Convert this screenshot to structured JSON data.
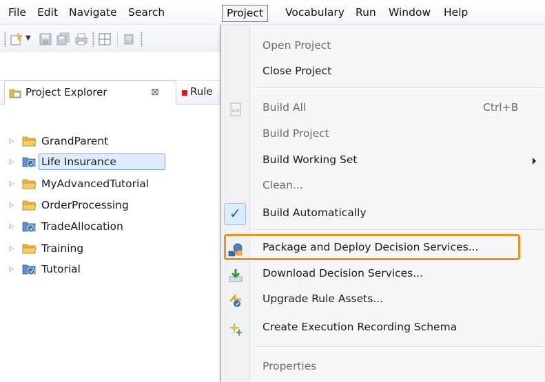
{
  "menubar": {
    "items": [
      {
        "label": "File"
      },
      {
        "label": "Edit"
      },
      {
        "label": "Navigate"
      },
      {
        "label": "Search"
      },
      {
        "label": "Project"
      },
      {
        "label": "Vocabulary"
      },
      {
        "label": "Run"
      },
      {
        "label": "Window"
      },
      {
        "label": "Help"
      }
    ],
    "active": "Project"
  },
  "explorer": {
    "tab_label": "Project Explorer",
    "close_symbol": "⊠",
    "other_tab_label": "Rule",
    "tree": [
      {
        "label": "GrandParent",
        "icon": "folder-icon"
      },
      {
        "label": "Life Insurance",
        "icon": "rule-project-icon",
        "selected": true
      },
      {
        "label": "MyAdvancedTutorial",
        "icon": "folder-icon"
      },
      {
        "label": "OrderProcessing",
        "icon": "folder-icon"
      },
      {
        "label": "TradeAllocation",
        "icon": "rule-project-icon"
      },
      {
        "label": "Training",
        "icon": "folder-icon"
      },
      {
        "label": "Tutorial",
        "icon": "rule-project-icon"
      }
    ]
  },
  "project_menu": {
    "items": [
      {
        "label": "Open Project",
        "enabled": false
      },
      {
        "label": "Close Project",
        "enabled": true
      },
      {
        "label": "Build All",
        "enabled": false,
        "shortcut": "Ctrl+B",
        "icon": "build-all-icon"
      },
      {
        "label": "Build Project",
        "enabled": false
      },
      {
        "label": "Build Working Set",
        "enabled": true,
        "submenu": true
      },
      {
        "label": "Clean...",
        "enabled": false
      },
      {
        "label": "Build Automatically",
        "enabled": true,
        "checked": true
      },
      {
        "label": "Package and Deploy Decision Services...",
        "enabled": true,
        "highlighted": true,
        "icon": "package-deploy-icon"
      },
      {
        "label": "Download Decision Services...",
        "enabled": true,
        "icon": "download-icon"
      },
      {
        "label": "Upgrade Rule Assets...",
        "enabled": true,
        "icon": "upgrade-icon"
      },
      {
        "label": "Create Execution Recording Schema",
        "enabled": true,
        "icon": "sparkle-icon"
      },
      {
        "label": "Properties",
        "enabled": false
      }
    ]
  },
  "colors": {
    "highlight": "#f0911f",
    "selection_bg": "#dcecfc",
    "selection_border": "#7da2ce",
    "folder": "#e9b645"
  }
}
